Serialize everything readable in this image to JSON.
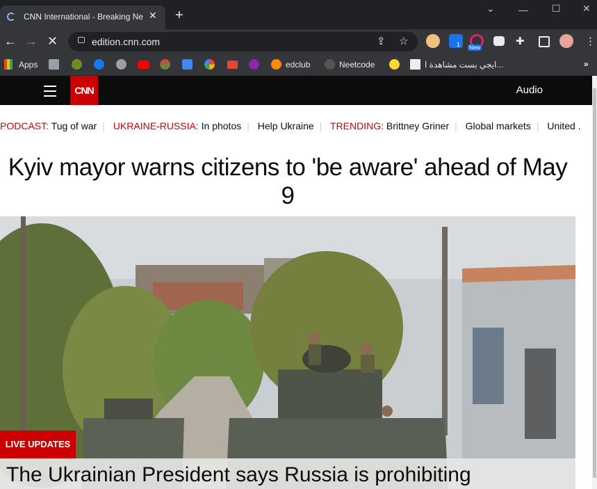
{
  "browser": {
    "tab_title": "CNN International - Breaking Ne",
    "url": "edition.cnn.com",
    "extension_badge": "1",
    "extension_new_badge": "New",
    "bookmarks": {
      "apps": "Apps",
      "edclub": "edclub",
      "neetcode": "Neetcode",
      "arabic": "ايجي بست مشاهدة ا..."
    }
  },
  "site": {
    "logo_text": "CNN",
    "audio_label": "Audio",
    "trending": [
      {
        "label": "PODCAST:",
        "text": "Tug of war"
      },
      {
        "label": "UKRAINE-RUSSIA:",
        "text": "In photos"
      },
      {
        "label": "",
        "text": "Help Ukraine"
      },
      {
        "label": "TRENDING:",
        "text": "Brittney Griner"
      },
      {
        "label": "",
        "text": "Global markets"
      },
      {
        "label": "",
        "text": "United ."
      }
    ],
    "headline": "Kyiv mayor warns citizens to 'be aware' ahead of May 9",
    "badge": "LIVE UPDATES",
    "subhead": "The Ukrainian President says Russia is prohibiting"
  }
}
